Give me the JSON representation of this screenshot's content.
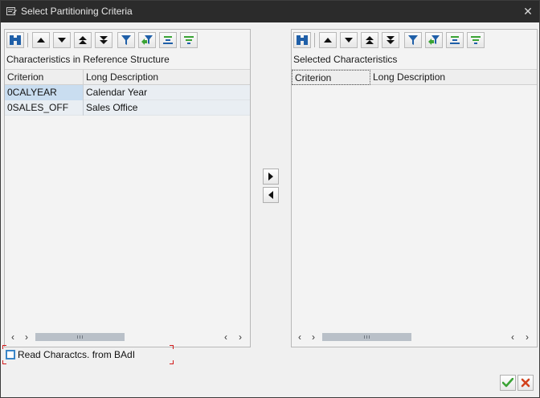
{
  "window": {
    "title": "Select Partitioning Criteria",
    "close_glyph": "✕"
  },
  "left_panel": {
    "title": "Characteristics in Reference Structure",
    "columns": [
      "Criterion",
      "Long Description"
    ],
    "rows": [
      {
        "criterion": "0CALYEAR",
        "description": "Calendar Year",
        "selected": true
      },
      {
        "criterion": "0SALES_OFF",
        "description": "Sales Office",
        "selected": false
      }
    ]
  },
  "right_panel": {
    "title": "Selected Characteristics",
    "columns": [
      "Criterion",
      "Long Description"
    ],
    "rows": []
  },
  "toolbar_icons": [
    "find-icon",
    "move-up-icon",
    "move-down-icon",
    "move-top-icon",
    "move-bottom-icon",
    "filter-icon",
    "delete-filter-icon",
    "sort-ascending-icon",
    "sort-descending-icon"
  ],
  "scroll_glyphs": {
    "left": "‹",
    "right": "›"
  },
  "checkbox": {
    "label": "Read Charactcs. from BAdI",
    "checked": false
  },
  "colors": {
    "titlebar": "#2b2b2b",
    "accent_blue": "#1f5fa8",
    "ok_green": "#3aa335",
    "cancel_red": "#d2421d",
    "selected_cell": "#c9ddf0",
    "required_marker": "#d21a1a"
  }
}
